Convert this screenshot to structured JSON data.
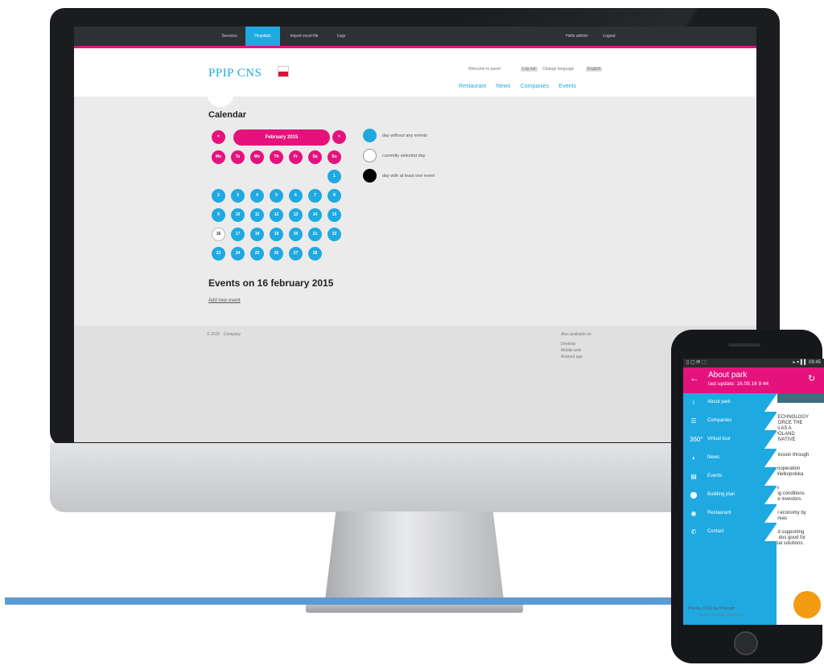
{
  "monitor": {
    "topnav": [
      "Services",
      "Hospitals",
      "Import excel file",
      "Logs"
    ],
    "user_links": [
      "Hello admin!",
      "Logout"
    ],
    "logo": "PPIP CNS",
    "header_small": [
      "Welcome to panel",
      "Log out",
      "Change language",
      "English"
    ],
    "main_menu": [
      "Restaurant",
      "News",
      "Companies",
      "Events"
    ],
    "calendar_title": "Calendar",
    "month_label": "February 2015",
    "prev": "<",
    "next": ">",
    "weekdays": [
      "Mo",
      "Tu",
      "We",
      "Th",
      "Fr",
      "Sa",
      "Su"
    ],
    "days": [
      "1",
      "2",
      "3",
      "4",
      "5",
      "6",
      "7",
      "8",
      "9",
      "10",
      "11",
      "12",
      "13",
      "14",
      "15",
      "16",
      "17",
      "18",
      "19",
      "20",
      "21",
      "22",
      "23",
      "24",
      "25",
      "26",
      "27",
      "28"
    ],
    "selected_day": "16",
    "legend": [
      "day without any events",
      "currently selected day",
      "day with at least one event"
    ],
    "events_title": "Events on 16 february 2015",
    "add_link": "Add new event",
    "footer_left": "© 2015 · Company",
    "footer_right_title": "Also available on",
    "footer_right_items": [
      "Desktop",
      "Mobile web",
      "Android app"
    ]
  },
  "phone": {
    "status_left": "▯ ▢ ✉ ⬚",
    "status_right": "▸ ▾ ▌▌ 09:45",
    "title": "About park",
    "subtitle": "last update: 16.09.16 9:44",
    "drawer": [
      {
        "icon": "i",
        "label": "About park"
      },
      {
        "icon": "☰",
        "label": "Companies"
      },
      {
        "icon": "360°",
        "label": "Virtual tour"
      },
      {
        "icon": "◗",
        "label": "News"
      },
      {
        "icon": "▤",
        "label": "Events"
      },
      {
        "icon": "⬤",
        "label": "Building plan"
      },
      {
        "icon": "◉",
        "label": "Restaurant"
      },
      {
        "icon": "✆",
        "label": "Contact"
      }
    ],
    "behind_lines": [
      "TECHNOLOGY",
      "FORCE THE",
      "IN AS A",
      "POLAND",
      "LIVATIVE",
      "mission through",
      "cooperation",
      "Wielkopolska",
      "ta",
      "ing conditions",
      "he investors.",
      "al economy by",
      "areas",
      "nd supporting",
      "s dos good for",
      "cial solutions."
    ],
    "bottom_text": "Pozna, CNS by Poznań",
    "bottom_sub": "some info, daily, disable now"
  },
  "colors": {
    "accent": "#1fa9e1",
    "brand": "#e5127d"
  }
}
